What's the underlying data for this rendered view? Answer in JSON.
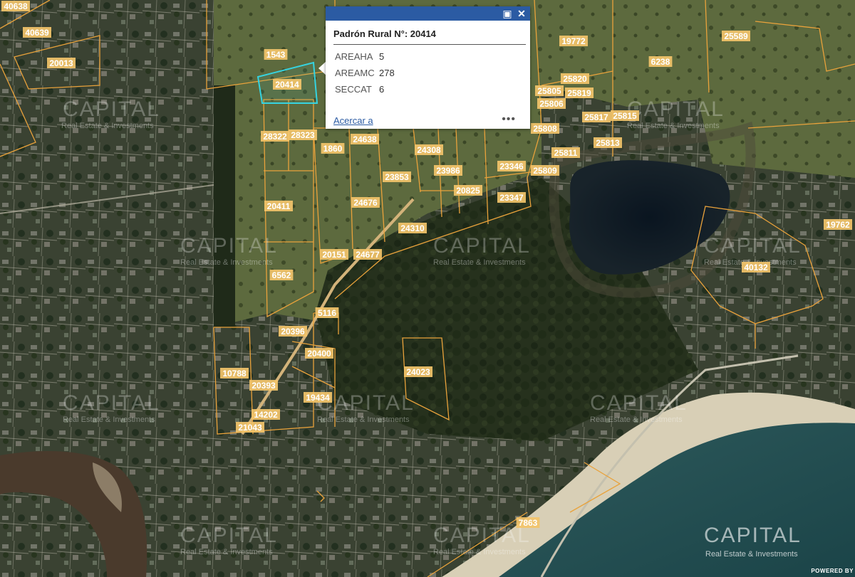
{
  "popup": {
    "title": "Padrón Rural N°: 20414",
    "attributes": [
      {
        "key": "AREAHA",
        "value": "5"
      },
      {
        "key": "AREAMC",
        "value": "278"
      },
      {
        "key": "SECCAT",
        "value": "6"
      }
    ],
    "zoom_link": "Acercar a",
    "more_label": "•••"
  },
  "parcels": [
    "40638",
    "40639",
    "20013",
    "1543",
    "20414",
    "19772",
    "6238",
    "25589",
    "25820",
    "25805",
    "25819",
    "25806",
    "25817",
    "25815",
    "25808",
    "25813",
    "25811",
    "25809",
    "28322",
    "28323",
    "1860",
    "24638",
    "24308",
    "23853",
    "23986",
    "23346",
    "20825",
    "23347",
    "20411",
    "24676",
    "24310",
    "20151",
    "24677",
    "6562",
    "5116",
    "20396",
    "20400",
    "24023",
    "10788",
    "20393",
    "19434",
    "14202",
    "21043",
    "19762",
    "40132",
    "7863"
  ],
  "watermark": {
    "brand": "CAPITAL",
    "tagline": "Real Estate & Investments"
  },
  "footer": {
    "powered": "POWERED BY"
  },
  "colors": {
    "parcel_line": "#e9a23b",
    "selected": "#35d3e0",
    "popup_header": "#2b5ba3"
  }
}
